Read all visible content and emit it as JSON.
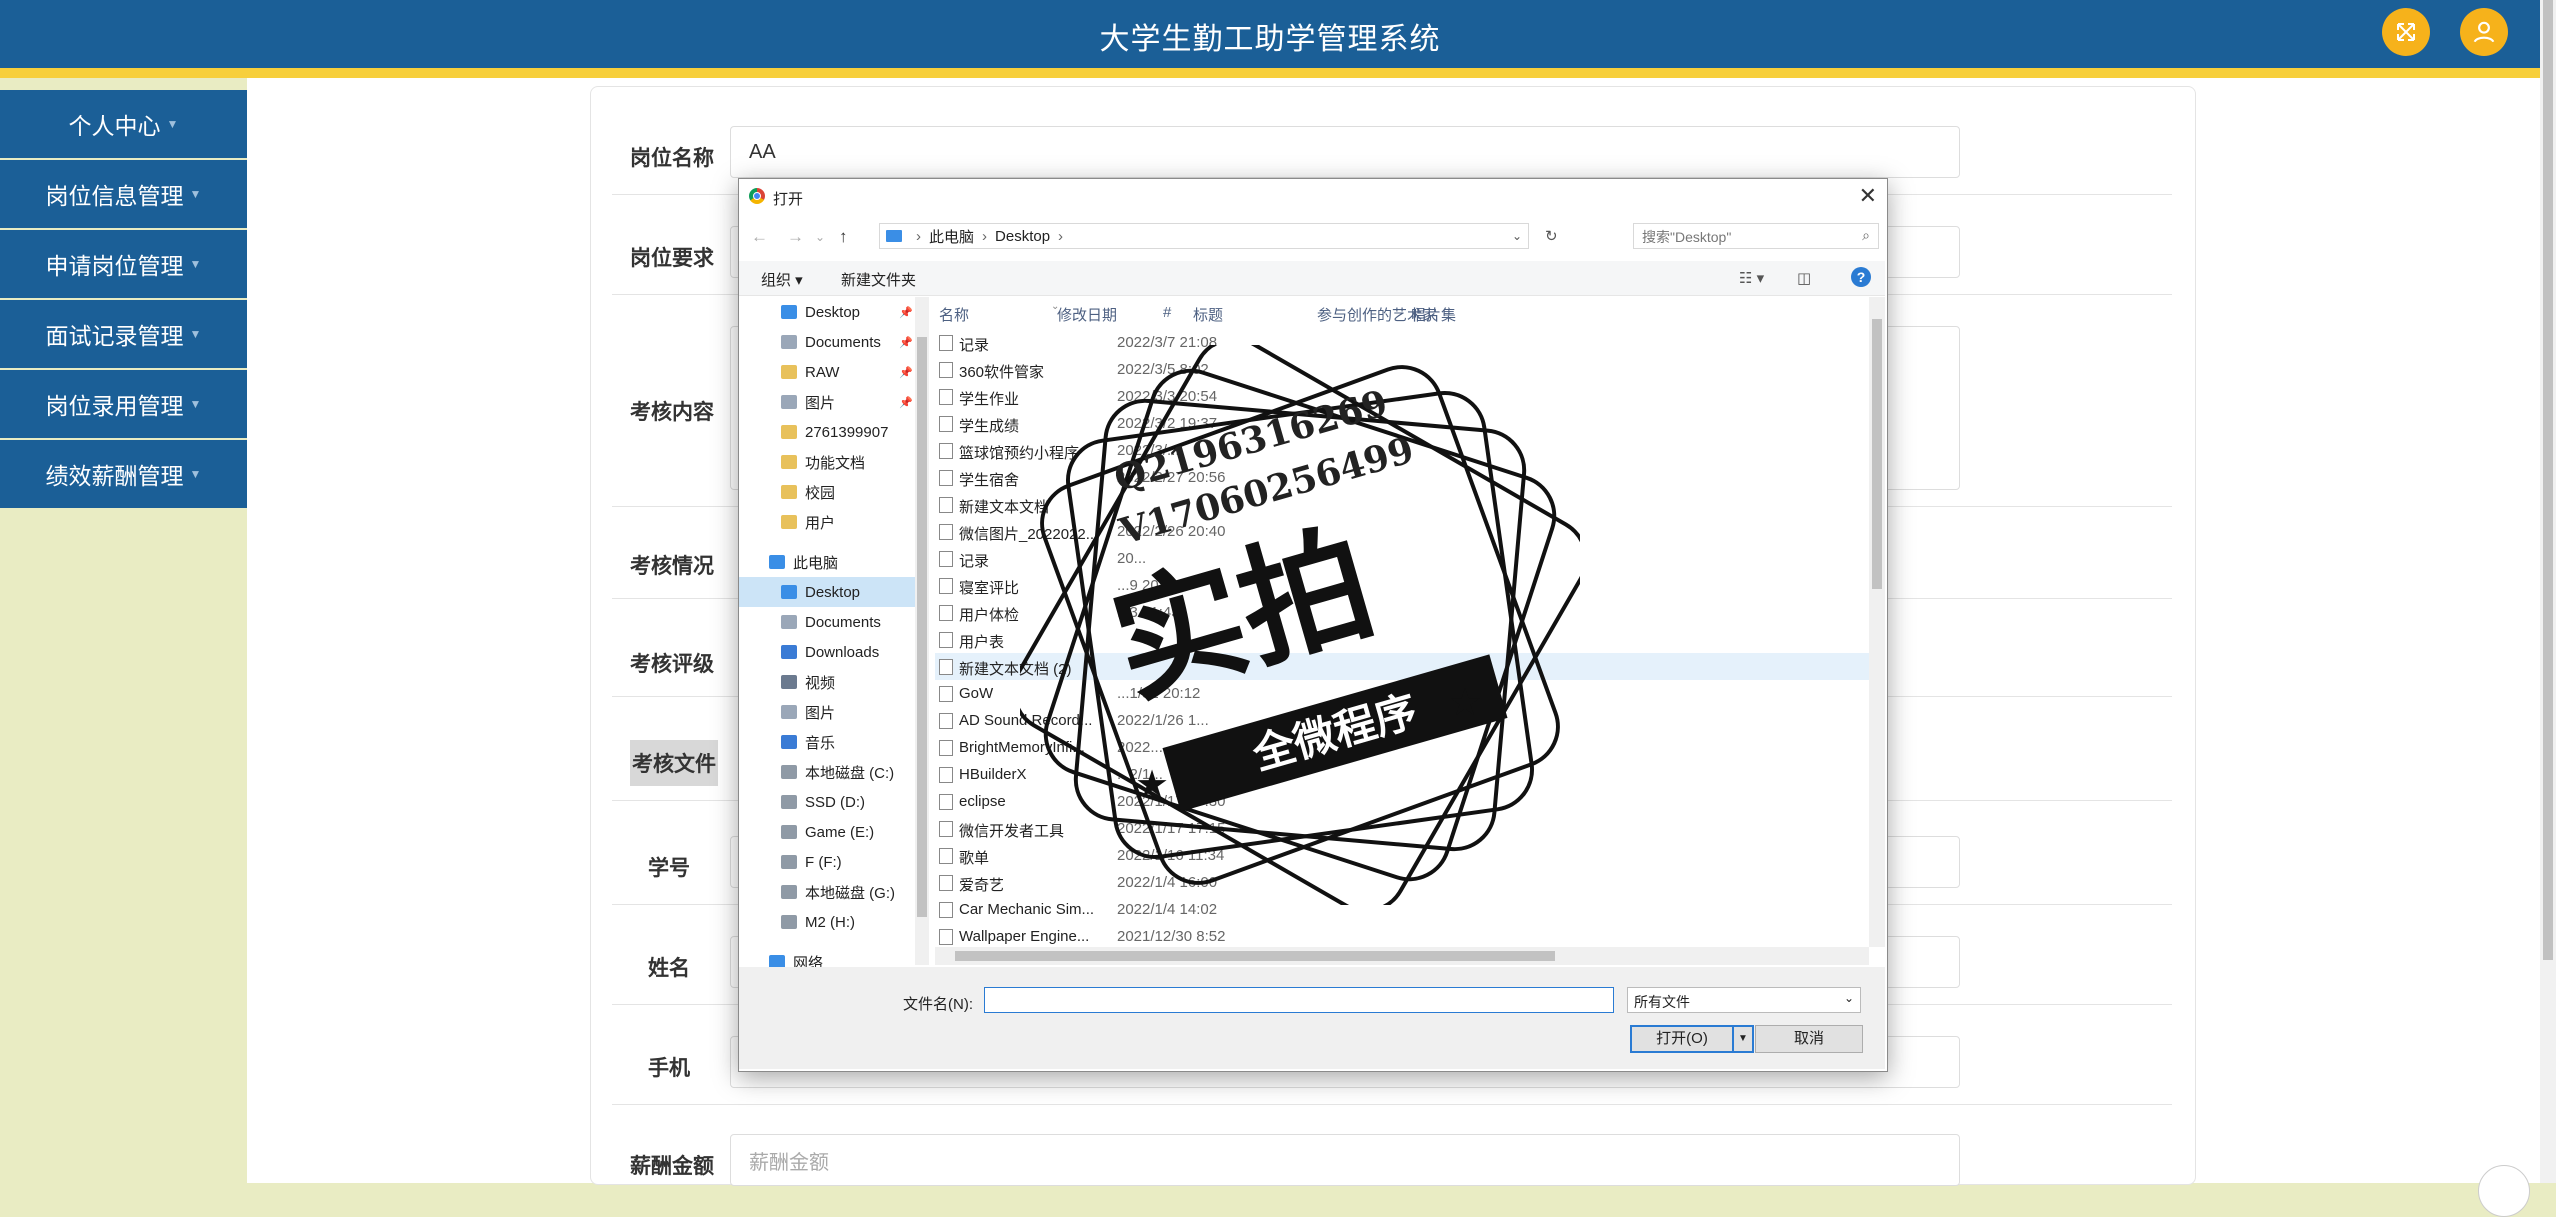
{
  "header": {
    "title": "大学生勤工助学管理系统"
  },
  "sidebar": {
    "items": [
      {
        "label": "个人中心"
      },
      {
        "label": "岗位信息管理"
      },
      {
        "label": "申请岗位管理"
      },
      {
        "label": "面试记录管理"
      },
      {
        "label": "岗位录用管理"
      },
      {
        "label": "绩效薪酬管理"
      }
    ]
  },
  "form": {
    "job_name_label": "岗位名称",
    "job_name_value": "AA",
    "job_req_label": "岗位要求",
    "assess_content_label": "考核内容",
    "assess_status_label": "考核情况",
    "assess_grade_label": "考核评级",
    "assess_file_label": "考核文件",
    "student_id_label": "学号",
    "name_label": "姓名",
    "phone_label": "手机",
    "salary_label": "薪酬金额",
    "salary_placeholder": "薪酬金额"
  },
  "dialog": {
    "title": "打开",
    "breadcrumb": [
      "此电脑",
      "Desktop"
    ],
    "search_placeholder": "搜索\"Desktop\"",
    "organize": "组织 ▾",
    "new_folder": "新建文件夹",
    "columns": {
      "name": "名称",
      "modified": "修改日期",
      "num": "#",
      "title": "标题",
      "artist": "参与创作的艺术家",
      "album": "唱片集"
    },
    "nav_items": [
      {
        "label": "Desktop",
        "color": "#3a8ee6",
        "pin": true
      },
      {
        "label": "Documents",
        "color": "#9aa7b8",
        "pin": true
      },
      {
        "label": "RAW",
        "color": "#e8c15b",
        "pin": true
      },
      {
        "label": "图片",
        "color": "#9aa7b8",
        "pin": true
      },
      {
        "label": "2761399907",
        "color": "#e8c15b",
        "pin": false
      },
      {
        "label": "功能文档",
        "color": "#e8c15b",
        "pin": false
      },
      {
        "label": "校园",
        "color": "#e8c15b",
        "pin": false
      },
      {
        "label": "用户",
        "color": "#e8c15b",
        "pin": false
      },
      {
        "label": "此电脑",
        "color": "#3a8ee6",
        "pin": false
      },
      {
        "label": "Desktop",
        "color": "#3a8ee6",
        "pin": false,
        "selected": true
      },
      {
        "label": "Documents",
        "color": "#9aa7b8",
        "pin": false
      },
      {
        "label": "Downloads",
        "color": "#3a7bd5",
        "pin": false
      },
      {
        "label": "视频",
        "color": "#6b7a8f",
        "pin": false
      },
      {
        "label": "图片",
        "color": "#9aa7b8",
        "pin": false
      },
      {
        "label": "音乐",
        "color": "#3a7bd5",
        "pin": false
      },
      {
        "label": "本地磁盘 (C:)",
        "color": "#8f9aa6",
        "pin": false
      },
      {
        "label": "SSD (D:)",
        "color": "#8f9aa6",
        "pin": false
      },
      {
        "label": "Game (E:)",
        "color": "#8f9aa6",
        "pin": false
      },
      {
        "label": "F (F:)",
        "color": "#8f9aa6",
        "pin": false
      },
      {
        "label": "本地磁盘 (G:)",
        "color": "#8f9aa6",
        "pin": false
      },
      {
        "label": "M2 (H:)",
        "color": "#8f9aa6",
        "pin": false
      },
      {
        "label": "网络",
        "color": "#3a8ee6",
        "pin": false
      }
    ],
    "files": [
      {
        "name": "记录",
        "date": "2022/3/7 21:08"
      },
      {
        "name": "360软件管家",
        "date": "2022/3/5 8:02"
      },
      {
        "name": "学生作业",
        "date": "2022/3/3 20:54"
      },
      {
        "name": "学生成绩",
        "date": "2022/3/2 19:37"
      },
      {
        "name": "篮球馆预约小程序",
        "date": "2022/3/..."
      },
      {
        "name": "学生宿舍",
        "date": "2022/2/27 20:56"
      },
      {
        "name": "新建文本文档",
        "date": ""
      },
      {
        "name": "微信图片_2022022...",
        "date": "2022/2/26 20:40"
      },
      {
        "name": "记录",
        "date": "20..."
      },
      {
        "name": "寝室评比",
        "date": "...9 20:12"
      },
      {
        "name": "用户体检",
        "date": "...3 21:43"
      },
      {
        "name": "用户表",
        "date": ""
      },
      {
        "name": "新建文本文档 (2)",
        "date": ""
      },
      {
        "name": "GoW",
        "date": "...1/31 20:12"
      },
      {
        "name": "AD Sound Record...",
        "date": "2022/1/26 1..."
      },
      {
        "name": "BrightMemoryInfi...",
        "date": "2022..."
      },
      {
        "name": "HBuilderX",
        "date": "...2/1..."
      },
      {
        "name": "eclipse",
        "date": "2022/1/17 17:30"
      },
      {
        "name": "微信开发者工具",
        "date": "2022/1/17 17:15"
      },
      {
        "name": "歌单",
        "date": "2022/1/16 11:34"
      },
      {
        "name": "爱奇艺",
        "date": "2022/1/4 16:00"
      },
      {
        "name": "Car Mechanic Sim...",
        "date": "2022/1/4 14:02"
      },
      {
        "name": "Wallpaper Engine...",
        "date": "2021/12/30 8:52"
      }
    ],
    "filename_label": "文件名(N):",
    "filetype": "所有文件",
    "open_label": "打开(O)",
    "cancel_label": "取消"
  },
  "watermark": {
    "line1": "Q2196316269",
    "line2": "V17060256499",
    "big": "实拍",
    "band": "全微程序"
  }
}
